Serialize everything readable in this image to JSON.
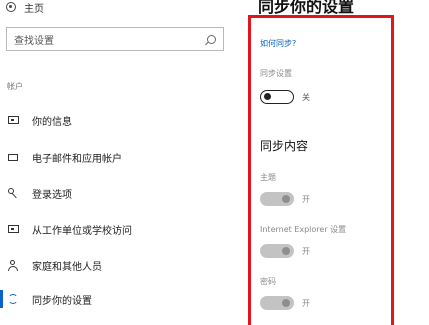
{
  "nav": {
    "home_label": "主页",
    "search_placeholder": "查找设置",
    "section_label": "帐户",
    "items": [
      {
        "label": "你的信息"
      },
      {
        "label": "电子邮件和应用帐户"
      },
      {
        "label": "登录选项"
      },
      {
        "label": "从工作单位或学校访问"
      },
      {
        "label": "家庭和其他人员"
      },
      {
        "label": "同步你的设置"
      }
    ],
    "active_index": 5
  },
  "main": {
    "title": "同步你的设置",
    "help_link": "如何同步?",
    "sync_settings_label": "同步设置",
    "sync_toggle_state": "关",
    "section_title": "同步内容",
    "items": [
      {
        "label": "主题",
        "state": "开"
      },
      {
        "label": "Internet Explorer 设置",
        "state": "开"
      },
      {
        "label": "密码",
        "state": "开"
      }
    ]
  },
  "colors": {
    "accent": "#0a63c7",
    "highlight_box": "#e4141b"
  }
}
